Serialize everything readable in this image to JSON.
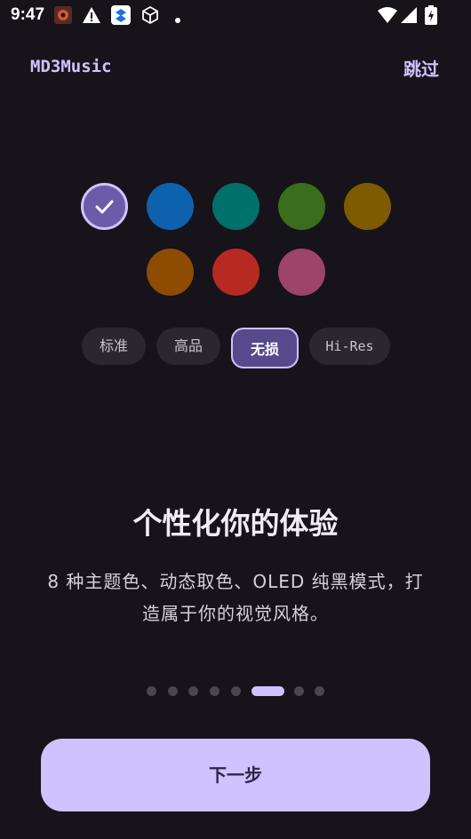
{
  "status_bar": {
    "time": "9:47",
    "icons": [
      "bug-app-icon",
      "warning-icon",
      "dropbox-icon",
      "cube-icon",
      "dot-icon",
      "wifi-icon",
      "signal-icon",
      "battery-icon"
    ]
  },
  "header": {
    "app_title": "MD3Music",
    "skip_label": "跳过"
  },
  "theme_colors": {
    "swatches": [
      "#6b5ba8",
      "#0e62ad",
      "#00706a",
      "#3a6d1c",
      "#7e5b00",
      "#8e4c00",
      "#b72a22",
      "#9e4469"
    ],
    "selected_index": 0
  },
  "quality": {
    "options": [
      "标准",
      "高品",
      "无损",
      "Hi-Res"
    ],
    "selected": "无损"
  },
  "content": {
    "headline": "个性化你的体验",
    "description": "8 种主题色、动态取色、OLED 纯黑模式，打造属于你的视觉风格。"
  },
  "pager": {
    "total": 8,
    "current_index": 5
  },
  "footer": {
    "next_label": "下一步"
  }
}
